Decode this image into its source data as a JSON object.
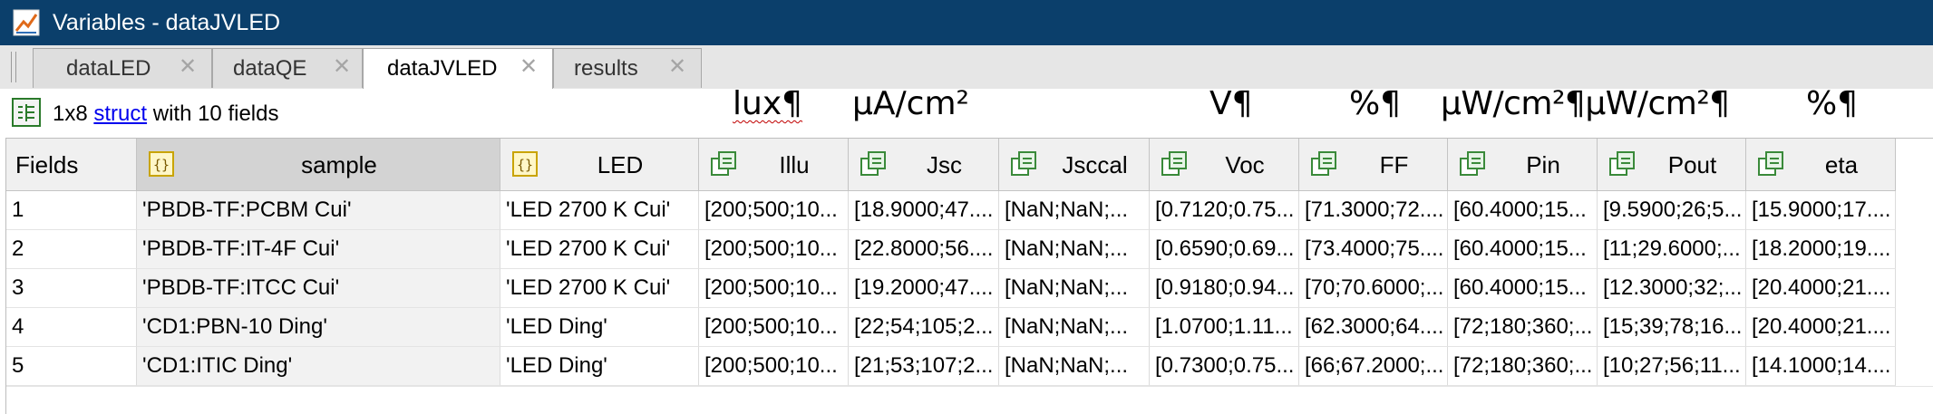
{
  "window": {
    "title": "Variables - dataJVLED",
    "icon": "variables-editor-icon"
  },
  "tabs": [
    {
      "label": "dataLED",
      "active": false
    },
    {
      "label": "dataQE",
      "active": false
    },
    {
      "label": "dataJVLED",
      "active": true
    },
    {
      "label": "results",
      "active": false
    }
  ],
  "tab_close_glyph": "✕",
  "info": {
    "prefix": "1x8 ",
    "link": "struct",
    "suffix": " with 10 fields"
  },
  "units": [
    "lux¶",
    "µA/cm²",
    "V¶",
    "%¶",
    "µW/cm²¶µW/cm²¶",
    "%¶"
  ],
  "grid": {
    "columns": [
      "Fields",
      "sample",
      "LED",
      "Illu",
      "Jsc",
      "Jsccal",
      "Voc",
      "FF",
      "Pin",
      "Pout",
      "eta"
    ],
    "column_icons": [
      "",
      "char-icon",
      "char-icon",
      "struct-field-icon",
      "struct-field-icon",
      "struct-field-icon",
      "struct-field-icon",
      "struct-field-icon",
      "struct-field-icon",
      "struct-field-icon",
      "struct-field-icon"
    ],
    "rows": [
      [
        "1",
        "'PBDB-TF:PCBM Cui'",
        "'LED 2700 K Cui'",
        "[200;500;10...",
        "[18.9000;47....",
        "[NaN;NaN;...",
        "[0.7120;0.75...",
        "[71.3000;72....",
        "[60.4000;15...",
        "[9.5900;26;5...",
        "[15.9000;17...."
      ],
      [
        "2",
        "'PBDB-TF:IT-4F Cui'",
        "'LED 2700 K Cui'",
        "[200;500;10...",
        "[22.8000;56....",
        "[NaN;NaN;...",
        "[0.6590;0.69...",
        "[73.4000;75....",
        "[60.4000;15...",
        "[11;29.6000;...",
        "[18.2000;19...."
      ],
      [
        "3",
        "'PBDB-TF:ITCC Cui'",
        "'LED 2700 K Cui'",
        "[200;500;10...",
        "[19.2000;47....",
        "[NaN;NaN;...",
        "[0.9180;0.94...",
        "[70;70.6000;...",
        "[60.4000;15...",
        "[12.3000;32;...",
        "[20.4000;21...."
      ],
      [
        "4",
        "'CD1:PBN-10 Ding'",
        "'LED Ding'",
        "[200;500;10...",
        "[22;54;105;2...",
        "[NaN;NaN;...",
        "[1.0700;1.11...",
        "[62.3000;64....",
        "[72;180;360;...",
        "[15;39;78;16...",
        "[20.4000;21...."
      ],
      [
        "5",
        "'CD1:ITIC Ding'",
        "'LED Ding'",
        "[200;500;10...",
        "[21;53;107;2...",
        "[NaN;NaN;...",
        "[0.7300;0.75...",
        "[66;67.2000;...",
        "[72;180;360;...",
        "[10;27;56;11...",
        "[14.1000;14...."
      ]
    ]
  }
}
